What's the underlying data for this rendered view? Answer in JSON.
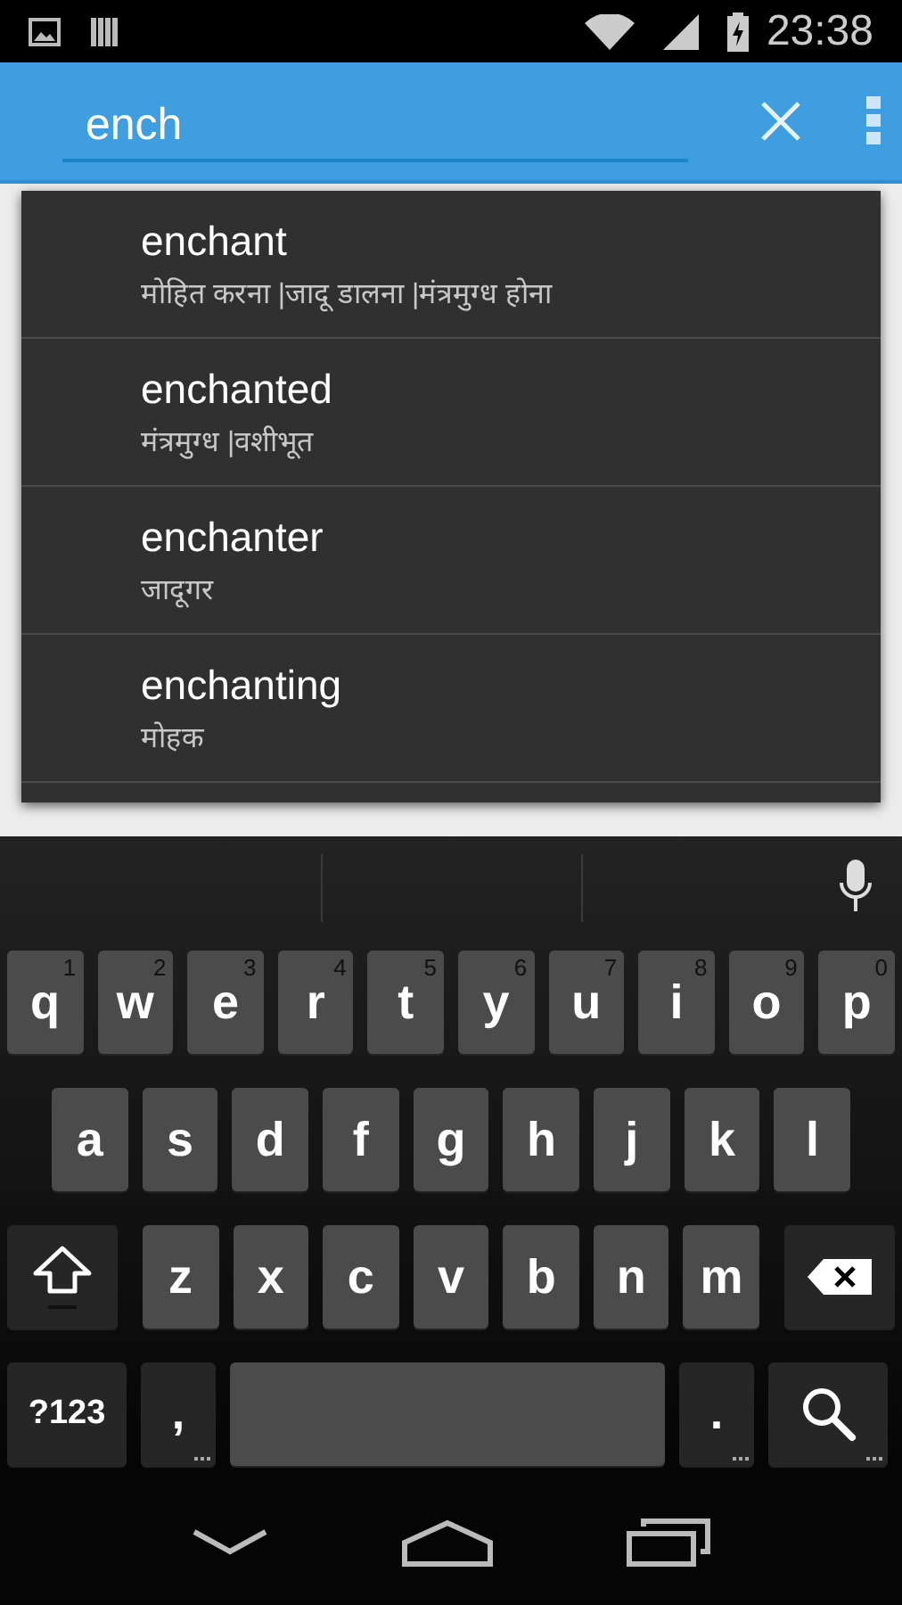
{
  "status_bar": {
    "time": "23:38"
  },
  "search": {
    "value": "ench"
  },
  "suggestions": [
    {
      "word": "enchant",
      "meaning": "मोहित करना |जादू डालना |मंत्रमुग्ध होना"
    },
    {
      "word": "enchanted",
      "meaning": "मंत्रमुग्ध |वशीभूत"
    },
    {
      "word": "enchanter",
      "meaning": "जादूगर"
    },
    {
      "word": "enchanting",
      "meaning": "मोहक"
    }
  ],
  "keyboard": {
    "key_rows": [
      {
        "keys": [
          {
            "kind": "letter",
            "label": "q",
            "hint": "1"
          },
          {
            "kind": "letter",
            "label": "w",
            "hint": "2"
          },
          {
            "kind": "letter",
            "label": "e",
            "hint": "3"
          },
          {
            "kind": "letter",
            "label": "r",
            "hint": "4"
          },
          {
            "kind": "letter",
            "label": "t",
            "hint": "5"
          },
          {
            "kind": "letter",
            "label": "y",
            "hint": "6"
          },
          {
            "kind": "letter",
            "label": "u",
            "hint": "7"
          },
          {
            "kind": "letter",
            "label": "i",
            "hint": "8"
          },
          {
            "kind": "letter",
            "label": "o",
            "hint": "9"
          },
          {
            "kind": "letter",
            "label": "p",
            "hint": "0"
          }
        ]
      },
      {
        "keys": [
          {
            "kind": "letter",
            "label": "a"
          },
          {
            "kind": "letter",
            "label": "s"
          },
          {
            "kind": "letter",
            "label": "d"
          },
          {
            "kind": "letter",
            "label": "f"
          },
          {
            "kind": "letter",
            "label": "g"
          },
          {
            "kind": "letter",
            "label": "h"
          },
          {
            "kind": "letter",
            "label": "j"
          },
          {
            "kind": "letter",
            "label": "k"
          },
          {
            "kind": "letter",
            "label": "l"
          }
        ]
      },
      {
        "keys": [
          {
            "kind": "shift"
          },
          {
            "kind": "letter",
            "label": "z"
          },
          {
            "kind": "letter",
            "label": "x"
          },
          {
            "kind": "letter",
            "label": "c"
          },
          {
            "kind": "letter",
            "label": "v"
          },
          {
            "kind": "letter",
            "label": "b"
          },
          {
            "kind": "letter",
            "label": "n"
          },
          {
            "kind": "letter",
            "label": "m"
          },
          {
            "kind": "backspace"
          }
        ]
      },
      {
        "keys": [
          {
            "kind": "symbols",
            "label": "?123"
          },
          {
            "kind": "punct",
            "label": ","
          },
          {
            "kind": "space"
          },
          {
            "kind": "punct",
            "label": "."
          },
          {
            "kind": "search"
          }
        ]
      }
    ]
  }
}
